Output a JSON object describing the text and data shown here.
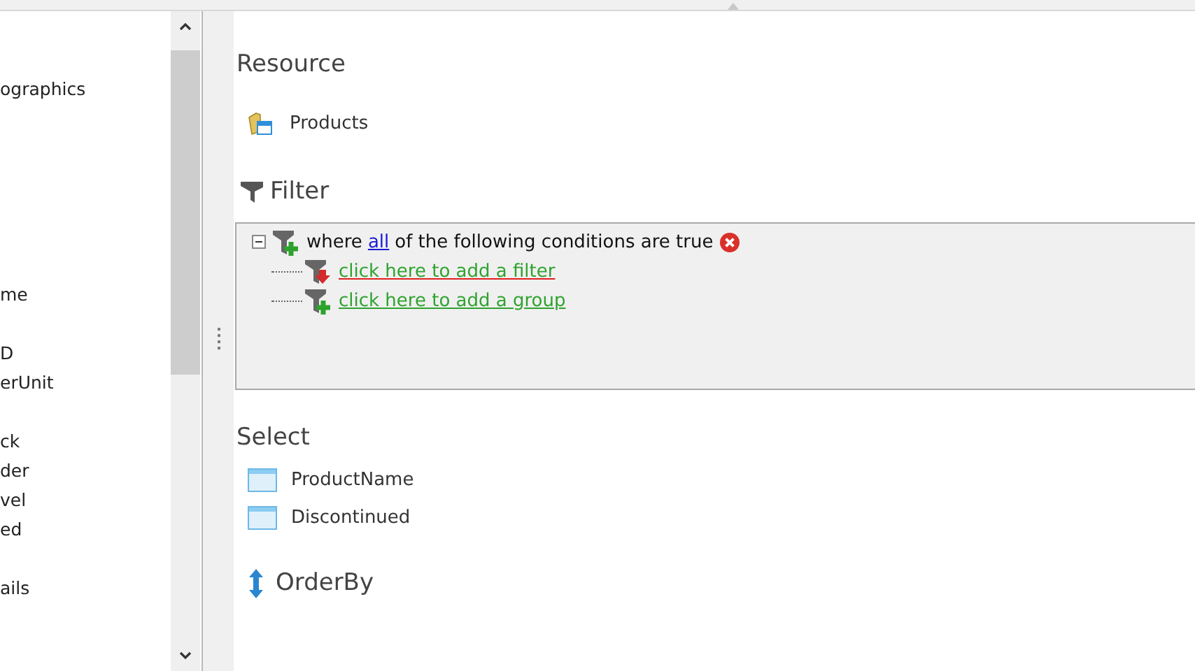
{
  "fields_panel": {
    "items": [
      "ographics",
      "me",
      "D",
      "erUnit",
      "ck",
      "der",
      "vel",
      "ed",
      "ails"
    ]
  },
  "resource": {
    "heading": "Resource",
    "item": "Products"
  },
  "filter": {
    "heading": "Filter",
    "root": {
      "prefix": "where",
      "quantifier": "all",
      "suffix": "of the following conditions are true",
      "expanded": true
    },
    "links": [
      {
        "kind": "filter",
        "text": "click here to add a filter",
        "hovered": true
      },
      {
        "kind": "group",
        "text": "click here to add a group",
        "hovered": false
      }
    ]
  },
  "select": {
    "heading": "Select",
    "columns": [
      "ProductName",
      "Discontinued"
    ]
  },
  "order_by": {
    "heading": "OrderBy"
  }
}
